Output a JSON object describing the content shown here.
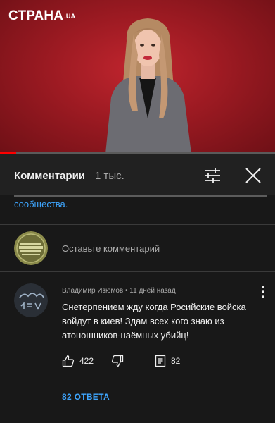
{
  "video": {
    "logo_text": "СТРАНА",
    "logo_suffix": ".UA",
    "progress_fraction": 0.06,
    "colors": {
      "background": "#a51c24",
      "progress": "#ff0000"
    }
  },
  "header": {
    "title": "Комментарии",
    "count": "1 тыс."
  },
  "description": {
    "link_text": "сообщества."
  },
  "add_comment": {
    "placeholder": "Оставьте комментарий"
  },
  "comment": {
    "author": "Владимир Изюмов",
    "time": "11 дней назад",
    "separator": "•",
    "text": "Снетерпением жду когда Росийские войска войдут в киев! Здам всех кого знаю из атоношников-наёмных убийц!",
    "likes": "422",
    "replies_count": "82",
    "replies_button": "82 ОТВЕТА"
  },
  "colors": {
    "background": "#181818",
    "header": "#212121",
    "link": "#3ea6ff",
    "secondary_text": "#aaaaaa"
  }
}
